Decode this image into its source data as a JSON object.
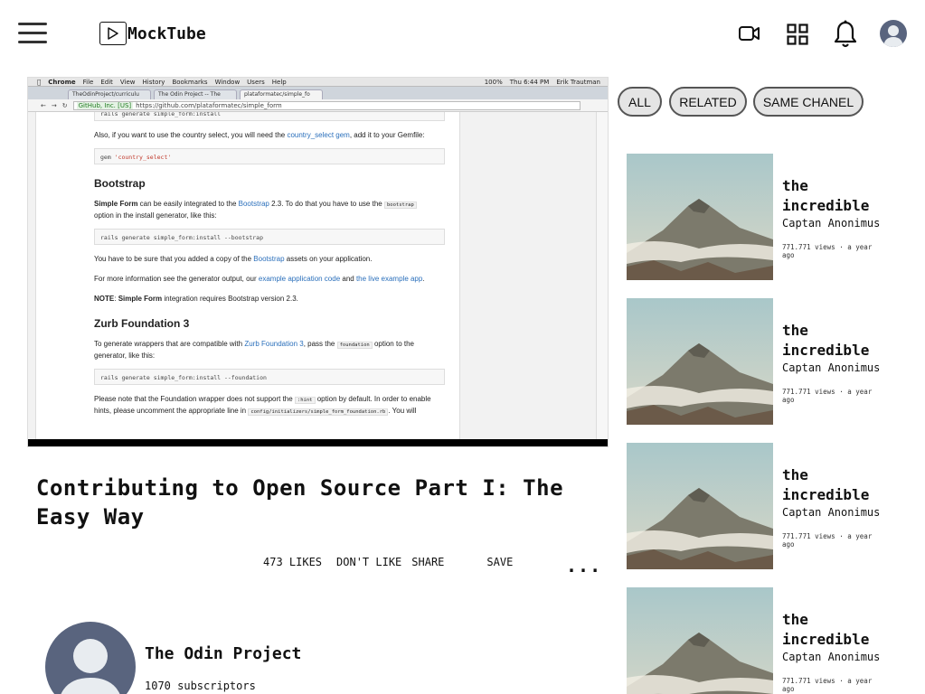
{
  "header": {
    "logo_text": "MockTube",
    "icons": [
      "menu-icon",
      "play-icon",
      "video-camera-icon",
      "apps-grid-icon",
      "bell-icon",
      "avatar"
    ]
  },
  "player": {
    "mac_menu": [
      "Chrome",
      "File",
      "Edit",
      "View",
      "History",
      "Bookmarks",
      "Window",
      "Users",
      "Help"
    ],
    "mac_status": [
      "100%",
      "Thu 6:44 PM",
      "Erik Trautman"
    ],
    "tabs": [
      "TheOdinProject/curriculu",
      "The Odin Project -- The",
      "plataformatec/simple_fo"
    ],
    "secure_label": "GitHub, Inc. [US]",
    "url": "https://github.com/plataformatec/simple_form",
    "page": {
      "cut_code": "rails generate simple_form:install",
      "country_text_a": "Also, if you want to use the country select, you will need the ",
      "country_link": "country_select gem",
      "country_text_b": ", add it to your Gemfile:",
      "gem_kw": "gem ",
      "gem_str": "'country_select'",
      "bootstrap_heading": "Bootstrap",
      "bs_bold": "Simple Form",
      "bs_text_a": " can be easily integrated to the ",
      "bs_link": "Bootstrap",
      "bs_text_b": " 2.3. To do that you have to use the ",
      "bs_code": "bootstrap",
      "bs_text_c": "option in the install generator, like this:",
      "bs_cmd": "rails generate simple_form:install --bootstrap",
      "assets_text_a": "You have to be sure that you added a copy of the ",
      "assets_link": "Bootstrap",
      "assets_text_b": " assets on your application.",
      "more_text_a": "For more information see the generator output, our ",
      "more_link_a": "example application code",
      "more_text_b": " and ",
      "more_link_b": "the live example app",
      "more_text_c": ".",
      "note_bold": "NOTE",
      "note_text_a": ": ",
      "note_bold_b": "Simple Form",
      "note_text_b": " integration requires Bootstrap version 2.3.",
      "zurb_heading": "Zurb Foundation 3",
      "zurb_text_a": "To generate wrappers that are compatible with ",
      "zurb_link": "Zurb Foundation 3",
      "zurb_text_b": ", pass the ",
      "zurb_code": "foundation",
      "zurb_text_c": " option to the",
      "zurb_text_d": "generator, like this:",
      "zurb_cmd": "rails generate simple_form:install --foundation",
      "wrapper_text_a": "Please note that the Foundation wrapper does not support the ",
      "wrapper_code": ":hint",
      "wrapper_text_b": " option by default. In order to enable",
      "wrapper_text_c": "hints, please uncomment the appropriate line in ",
      "wrapper_code_b": "config/initializers/simple_form_foundation.rb",
      "wrapper_text_d": ". You will"
    }
  },
  "video": {
    "title": "Contributing to Open Source Part I: The Easy Way",
    "likes": "473 LIKES",
    "dislike": "DON'T LIKE",
    "share": "SHARE",
    "save": "SAVE",
    "more": "..."
  },
  "channel": {
    "name": "The Odin Project",
    "subscribers": "1070 subscriptors"
  },
  "filters": [
    {
      "label": "ALL"
    },
    {
      "label": "RELATED"
    },
    {
      "label": "SAME CHANEL"
    }
  ],
  "related": [
    {
      "title": "the incredible",
      "author": "Captan Anonimus",
      "meta": "771.771 views · a year ago"
    },
    {
      "title": "the incredible",
      "author": "Captan Anonimus",
      "meta": "771.771 views · a year ago"
    },
    {
      "title": "the incredible",
      "author": "Captan Anonimus",
      "meta": "771.771 views · a year ago"
    },
    {
      "title": "the incredible",
      "author": "Captan Anonimus",
      "meta": "771.771 views · a year ago"
    }
  ]
}
